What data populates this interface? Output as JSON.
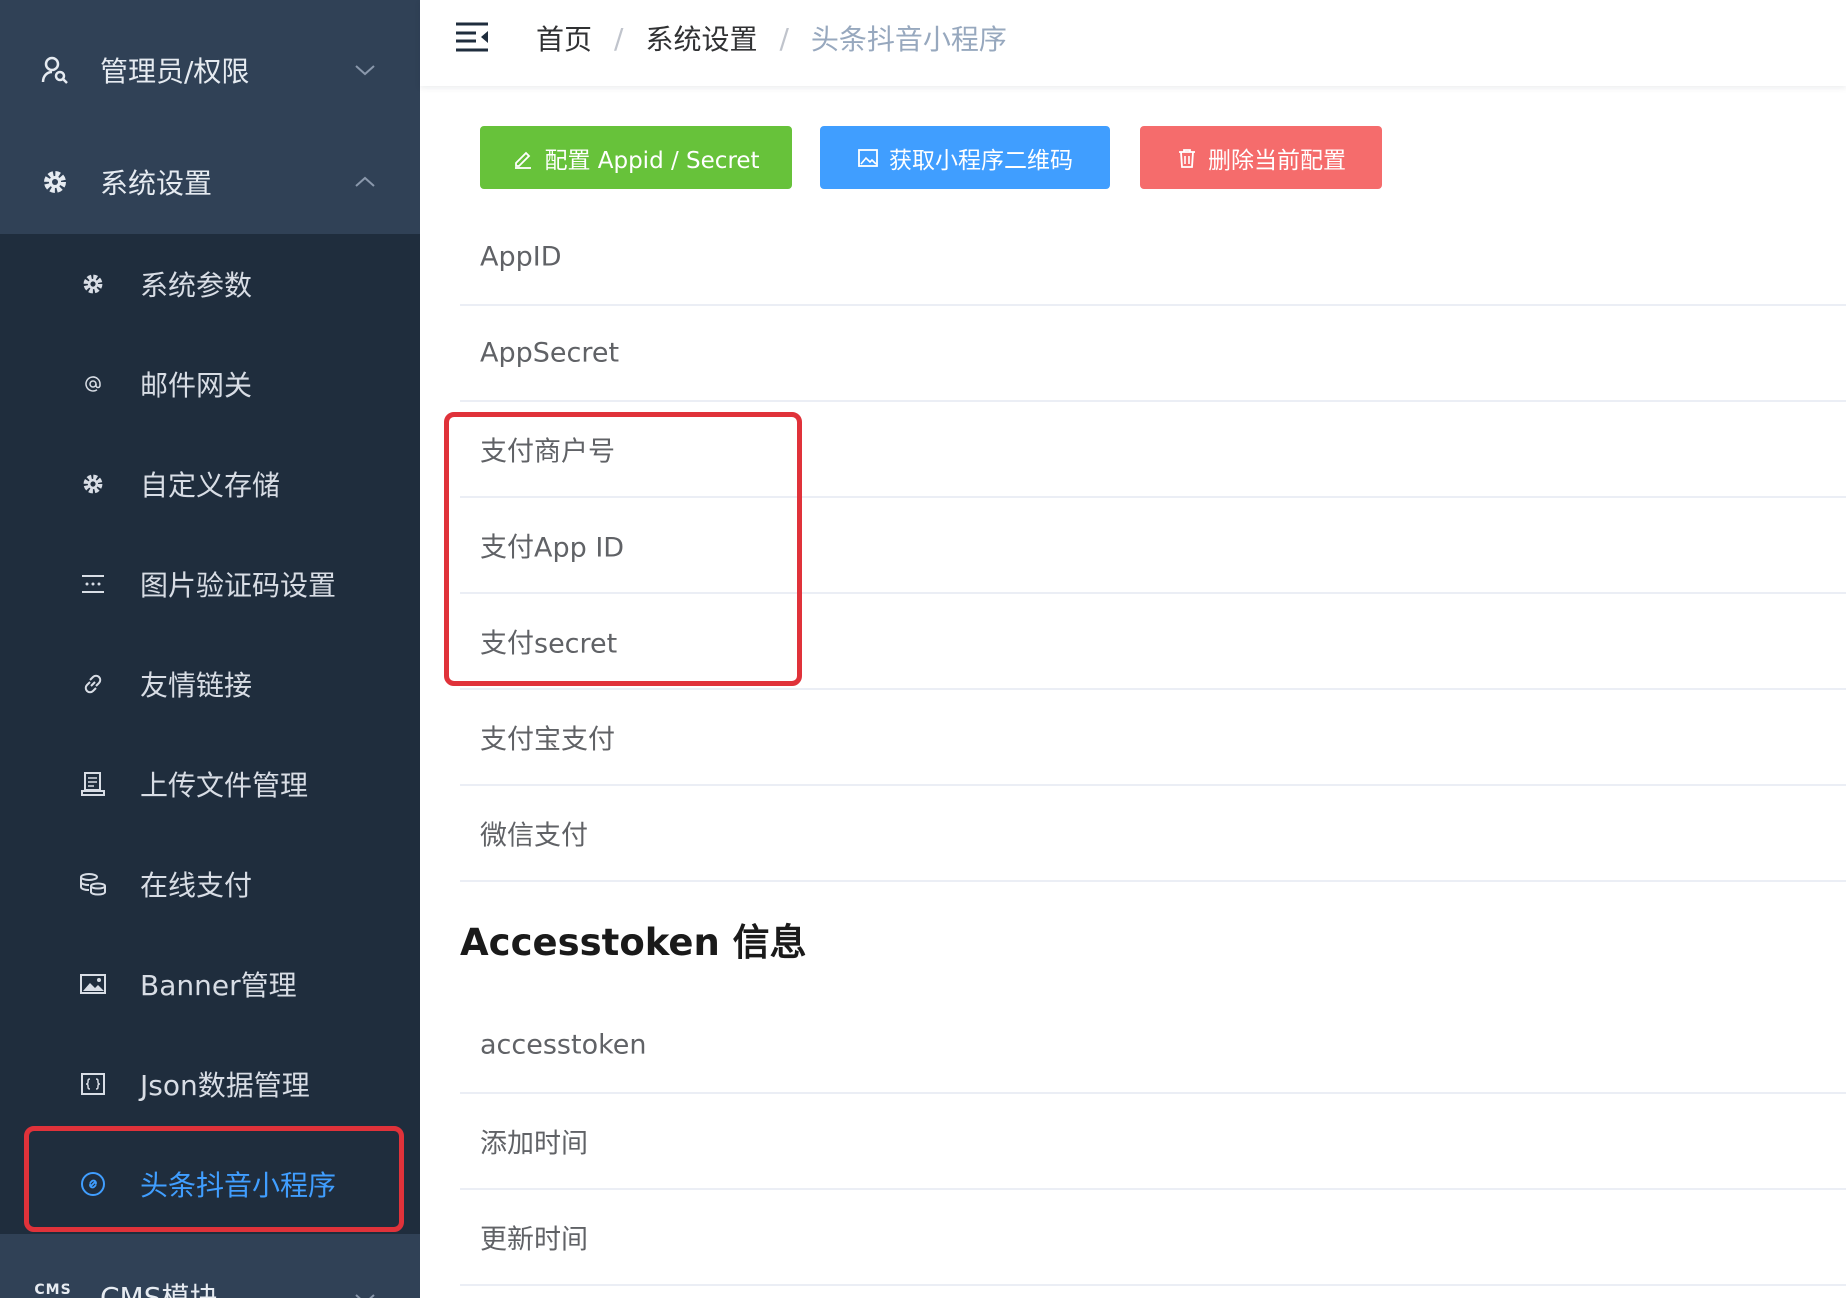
{
  "sidebar": {
    "menus": [
      {
        "label": "管理员/权限",
        "icon": "user-key-icon",
        "expanded": false
      },
      {
        "label": "系统设置",
        "icon": "gear-icon",
        "expanded": true
      },
      {
        "label": "CMS模块",
        "icon": "cms-icon",
        "icon_text": "CMS",
        "expanded": false
      }
    ],
    "items": [
      {
        "label": "系统参数",
        "icon": "gear-icon"
      },
      {
        "label": "邮件网关",
        "icon": "at-icon"
      },
      {
        "label": "自定义存储",
        "icon": "gear-icon"
      },
      {
        "label": "图片验证码设置",
        "icon": "captcha-icon"
      },
      {
        "label": "友情链接",
        "icon": "link-icon"
      },
      {
        "label": "上传文件管理",
        "icon": "file-manage-icon"
      },
      {
        "label": "在线支付",
        "icon": "coins-icon"
      },
      {
        "label": "Banner管理",
        "icon": "picture-icon"
      },
      {
        "label": "Json数据管理",
        "icon": "json-icon"
      },
      {
        "label": "头条抖音小程序",
        "icon": "miniprogram-icon",
        "active": true
      }
    ]
  },
  "header": {
    "breadcrumb": [
      "首页",
      "系统设置",
      "头条抖音小程序"
    ],
    "separator": "/"
  },
  "toolbar": {
    "config_label": "配置 Appid / Secret",
    "qrcode_label": "获取小程序二维码",
    "delete_label": "删除当前配置"
  },
  "config_rows": [
    "AppID",
    "AppSecret",
    "支付商户号",
    "支付App ID",
    "支付secret",
    "支付宝支付",
    "微信支付"
  ],
  "accesstoken": {
    "title": "Accesstoken 信息",
    "rows": [
      "accesstoken",
      "添加时间",
      "更新时间"
    ]
  },
  "colors": {
    "sidebar_bg": "#304156",
    "submenu_bg": "#1f2d3d",
    "accent": "#409eff",
    "success": "#67c23a",
    "danger": "#f56c6c",
    "highlight_box": "#e0323a"
  }
}
